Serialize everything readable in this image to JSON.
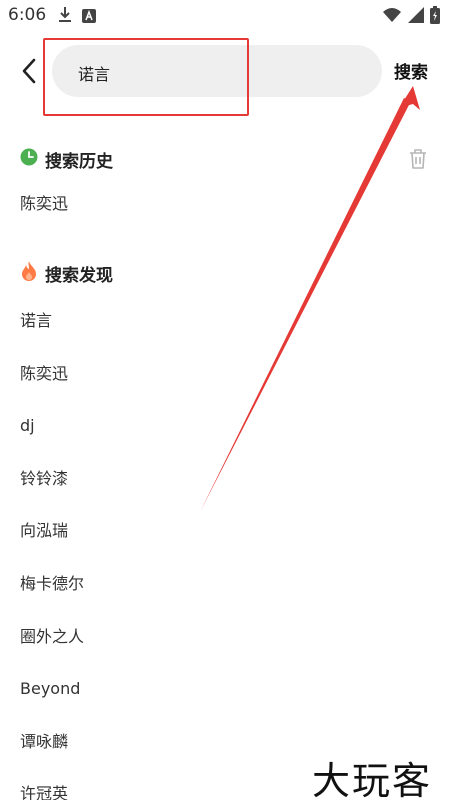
{
  "status_bar": {
    "time": "6:06",
    "left_icons": [
      "download-icon",
      "a-box-icon"
    ],
    "right_icons": [
      "wifi-icon",
      "signal-icon",
      "battery-icon"
    ]
  },
  "search": {
    "query": "诺言",
    "action_label": "搜索"
  },
  "history": {
    "title": "搜索历史",
    "icon": "clock-icon",
    "items": [
      "陈奕迅"
    ]
  },
  "discover": {
    "title": "搜索发现",
    "icon": "fire-icon",
    "items": [
      "诺言",
      "陈奕迅",
      "dj",
      "铃铃漆",
      "向泓瑞",
      "梅卡德尔",
      "圈外之人",
      "Beyond",
      "谭咏麟",
      "许冠英"
    ]
  },
  "watermark": "大玩客",
  "colors": {
    "annotation_red": "#e53935",
    "clock_green": "#4caf50",
    "fire_orange": "#ff7a45",
    "search_box_bg": "#efefef"
  }
}
